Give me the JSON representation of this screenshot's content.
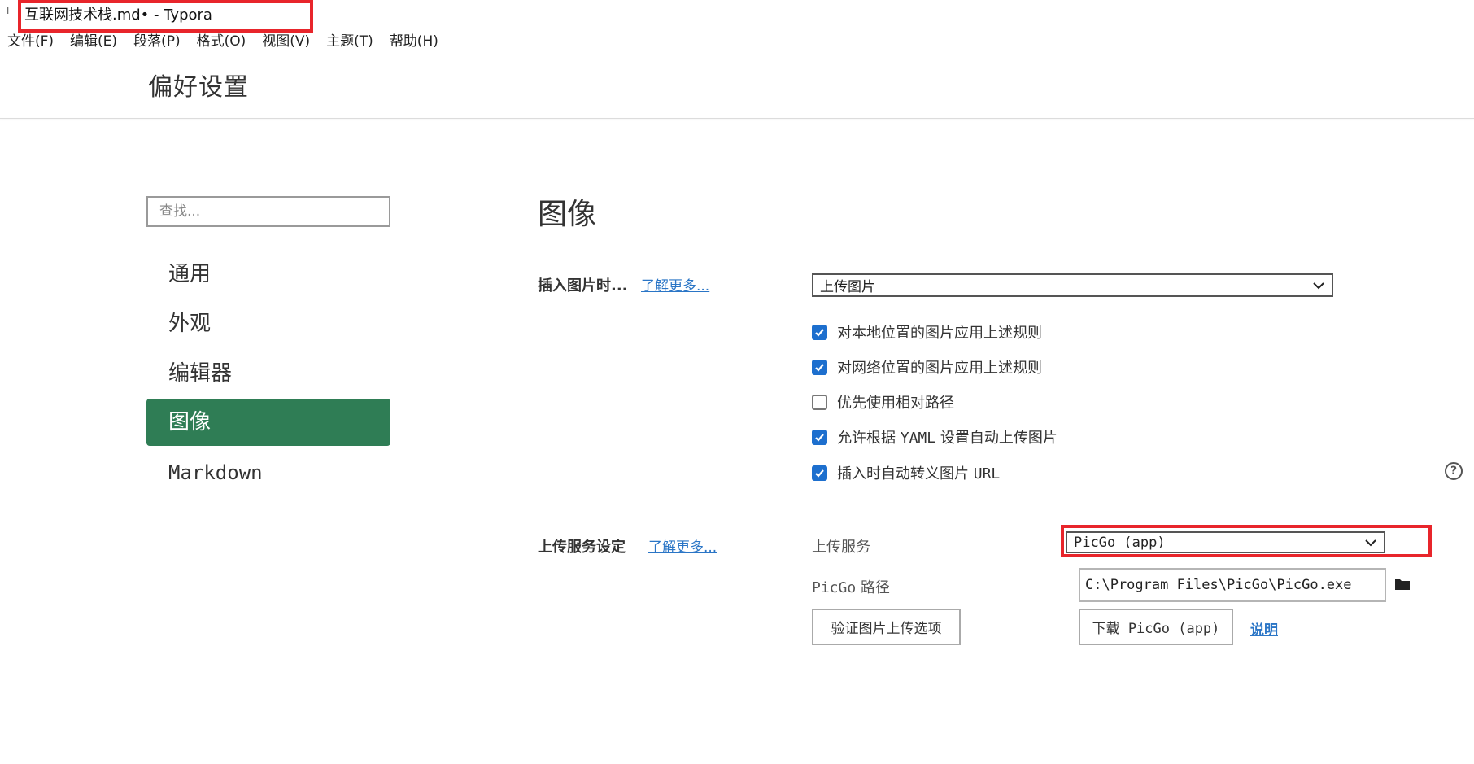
{
  "titlebar": {
    "icon_text": "T",
    "title": "互联网技术栈.md• - Typora"
  },
  "menubar": {
    "items": [
      "文件(F)",
      "编辑(E)",
      "段落(P)",
      "格式(O)",
      "视图(V)",
      "主题(T)",
      "帮助(H)"
    ]
  },
  "prefs": {
    "title": "偏好设置"
  },
  "sidebar": {
    "search_placeholder": "查找...",
    "items": [
      {
        "label": "通用"
      },
      {
        "label": "外观"
      },
      {
        "label": "编辑器"
      },
      {
        "label": "图像",
        "active": true
      },
      {
        "label": "Markdown"
      }
    ]
  },
  "image_section": {
    "title": "图像",
    "insert": {
      "label": "插入图片时...",
      "learn_more": "了解更多...",
      "selected": "上传图片"
    },
    "options": [
      {
        "pre": "对本地位置的图片应用上述规则",
        "code": "",
        "post": "",
        "checked": true
      },
      {
        "pre": "对网络位置的图片应用上述规则",
        "code": "",
        "post": "",
        "checked": true
      },
      {
        "pre": "优先使用相对路径",
        "code": "",
        "post": "",
        "checked": false
      },
      {
        "pre": "允许根据 ",
        "code": "YAML",
        "post": " 设置自动上传图片",
        "checked": true
      },
      {
        "pre": "插入时自动转义图片 ",
        "code": "URL",
        "post": "",
        "checked": true
      }
    ],
    "help_icon_text": "?",
    "upload": {
      "label": "上传服务设定",
      "learn_more": "了解更多...",
      "service_label": "上传服务",
      "service_selected": "PicGo (app)",
      "path_label_code": "PicGo",
      "path_label_text": " 路径",
      "path_value": "C:\\Program Files\\PicGo\\PicGo.exe",
      "verify_button": "验证图片上传选项",
      "download_button": "下载 PicGo (app)",
      "doc_link": "说明"
    }
  },
  "colors": {
    "accent": "#2f7d55",
    "checkbox": "#1d6fce",
    "link": "#2a75c6",
    "highlight": "#e8252b"
  }
}
